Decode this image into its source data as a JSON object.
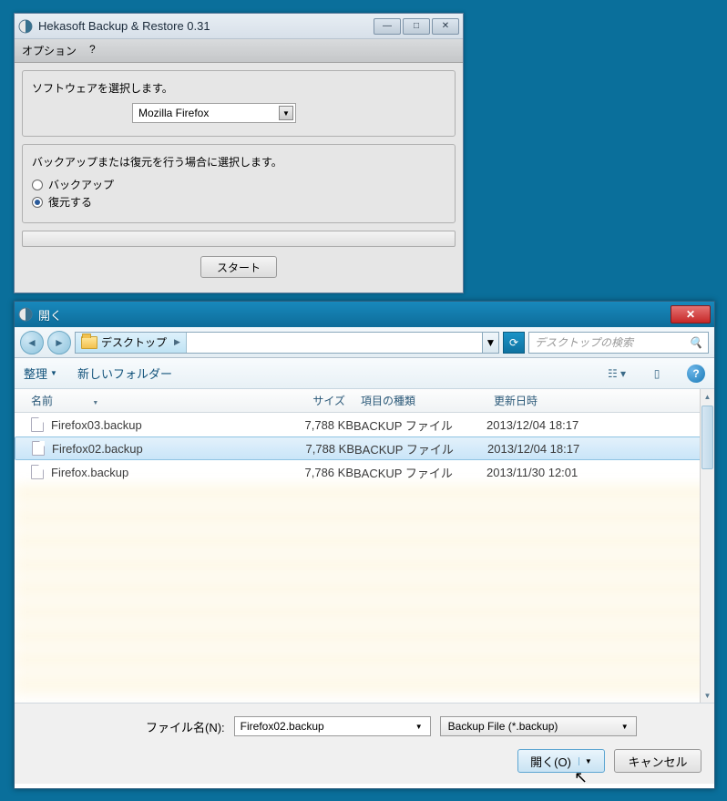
{
  "win1": {
    "title": "Hekasoft Backup & Restore 0.31",
    "menu": {
      "options": "オプション",
      "help": "?"
    },
    "section1_label": "ソフトウェアを選択します。",
    "software_selected": "Mozilla Firefox",
    "section2_label": "バックアップまたは復元を行う場合に選択します。",
    "radio_backup": "バックアップ",
    "radio_restore": "復元する",
    "start_btn": "スタート"
  },
  "win2": {
    "title": "開く",
    "path_label": "デスクトップ",
    "path_sep": "▸",
    "search_placeholder": "デスクトップの検索",
    "toolbar": {
      "organize": "整理",
      "new_folder": "新しいフォルダー"
    },
    "columns": {
      "name": "名前",
      "size": "サイズ",
      "type": "項目の種類",
      "date": "更新日時"
    },
    "rows": [
      {
        "name": "Firefox03.backup",
        "size": "7,788 KB",
        "type": "BACKUP ファイル",
        "date": "2013/12/04 18:17",
        "selected": false
      },
      {
        "name": "Firefox02.backup",
        "size": "7,788 KB",
        "type": "BACKUP ファイル",
        "date": "2013/12/04 18:17",
        "selected": true
      },
      {
        "name": "Firefox.backup",
        "size": "7,786 KB",
        "type": "BACKUP ファイル",
        "date": "2013/11/30 12:01",
        "selected": false
      }
    ],
    "filename_label": "ファイル名(N):",
    "filename_value": "Firefox02.backup",
    "filter_value": "Backup File (*.backup)",
    "open_btn": "開く(O)",
    "cancel_btn": "キャンセル"
  }
}
